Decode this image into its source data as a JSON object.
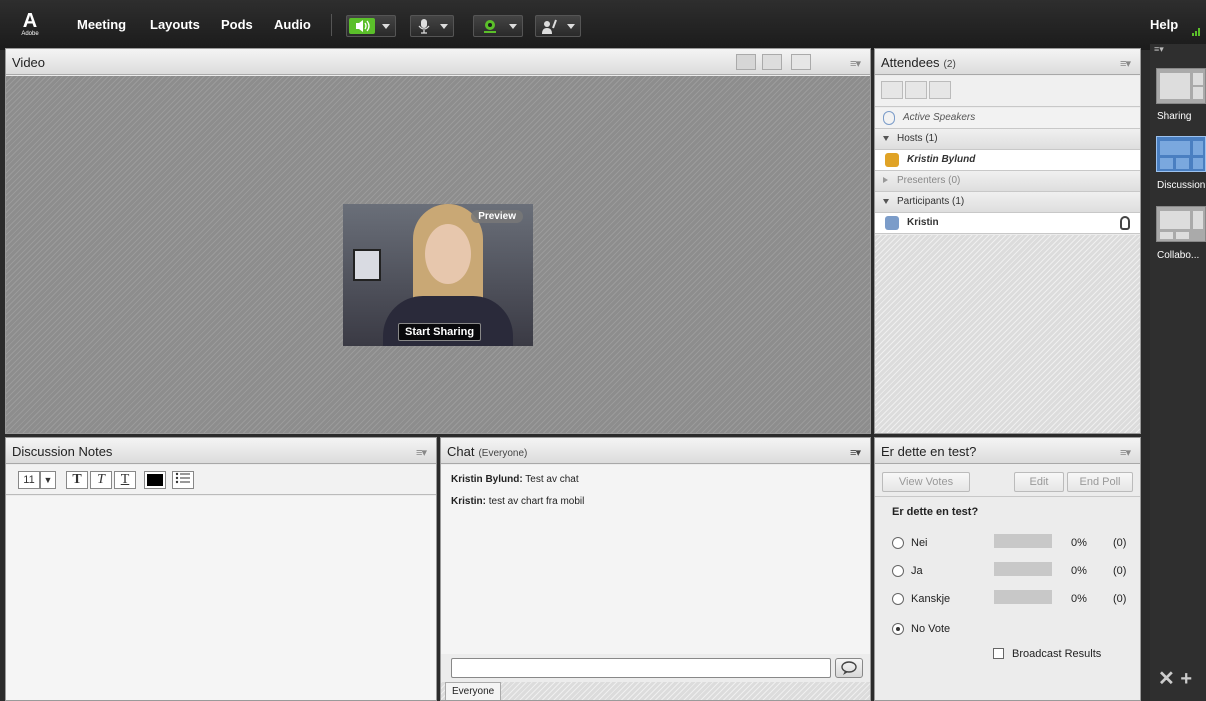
{
  "menubar": {
    "logo_text": "Adobe",
    "items": [
      "Meeting",
      "Layouts",
      "Pods",
      "Audio"
    ],
    "help": "Help"
  },
  "video": {
    "title": "Video",
    "preview_label": "Preview",
    "start_sharing": "Start Sharing"
  },
  "attendees": {
    "title": "Attendees",
    "count": "(2)",
    "active_speakers": "Active Speakers",
    "groups": [
      {
        "label": "Hosts (1)",
        "expanded": true,
        "members": [
          "Kristin Bylund"
        ]
      },
      {
        "label": "Presenters (0)",
        "expanded": false,
        "members": []
      },
      {
        "label": "Participants (1)",
        "expanded": true,
        "members": [
          "Kristin"
        ]
      }
    ]
  },
  "notes": {
    "title": "Discussion Notes",
    "font_size": "11",
    "bold": "T",
    "italic": "T",
    "underline": "T"
  },
  "chat": {
    "title": "Chat",
    "scope": "(Everyone)",
    "messages": [
      {
        "sender": "Kristin Bylund:",
        "text": " Test av chat"
      },
      {
        "sender": "Kristin:",
        "text": " test av chart fra mobil"
      }
    ],
    "input_value": "",
    "tab": "Everyone"
  },
  "poll": {
    "title": "Er dette en test?",
    "view_votes": "View Votes",
    "edit": "Edit",
    "end_poll": "End Poll",
    "question": "Er dette en test?",
    "options": [
      {
        "label": "Nei",
        "percent": "0%",
        "count": "(0)",
        "fraction": 0,
        "selected": false
      },
      {
        "label": "Ja",
        "percent": "0%",
        "count": "(0)",
        "fraction": 0,
        "selected": false
      },
      {
        "label": "Kanskje",
        "percent": "0%",
        "count": "(0)",
        "fraction": 0,
        "selected": false
      },
      {
        "label": "No Vote",
        "percent": "",
        "count": "",
        "fraction": 0,
        "selected": true
      }
    ],
    "broadcast": "Broadcast Results"
  },
  "layouts": {
    "items": [
      "Sharing",
      "Discussion",
      "Collabo..."
    ],
    "active": "Discussion"
  },
  "colors": {
    "accent_green": "#5bbf2a",
    "active_layout": "#4a7fc1",
    "host_icon": "#e0a326",
    "participant_icon": "#7b9cc9"
  }
}
